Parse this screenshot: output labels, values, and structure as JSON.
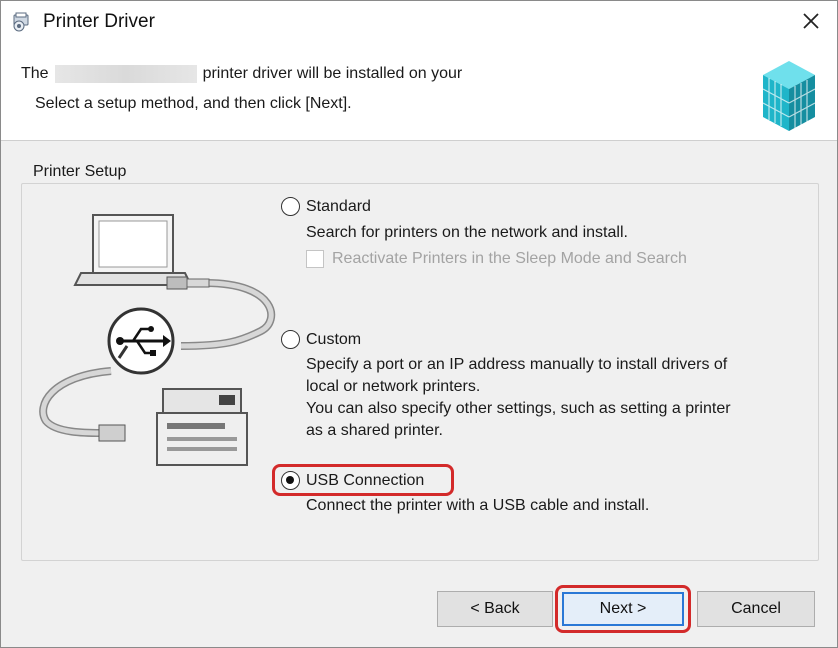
{
  "window": {
    "title": "Printer Driver",
    "close_glyph": "✕"
  },
  "header": {
    "line1_prefix": "The",
    "line1_suffix": "printer driver will be installed on your",
    "line2": "Select a setup method, and then click [Next]."
  },
  "printer_setup": {
    "legend": "Printer Setup",
    "options": [
      {
        "label": "Standard",
        "selected": false,
        "description": [
          "Search for printers on the network and install."
        ],
        "sub_checkbox": {
          "label": "Reactivate Printers in the Sleep Mode and Search",
          "checked": false,
          "enabled": false
        }
      },
      {
        "label": "Custom",
        "selected": false,
        "description": [
          "Specify a port or an IP address manually to install drivers of",
          "local or network printers.",
          "You can also specify other settings, such as setting a printer",
          "as a shared printer."
        ]
      },
      {
        "label": "USB Connection",
        "selected": true,
        "description": [
          "Connect the printer with a USB cable and install."
        ]
      }
    ]
  },
  "buttons": {
    "back": "< Back",
    "next": "Next >",
    "cancel": "Cancel"
  },
  "colors": {
    "highlight": "#d32a2a",
    "focus": "#2a78d6",
    "logo": "#1fb5c9"
  },
  "icons": [
    "printer-driver-app-icon",
    "close-icon",
    "product-logo-icon",
    "usb-icon",
    "laptop-icon",
    "printer-icon"
  ]
}
